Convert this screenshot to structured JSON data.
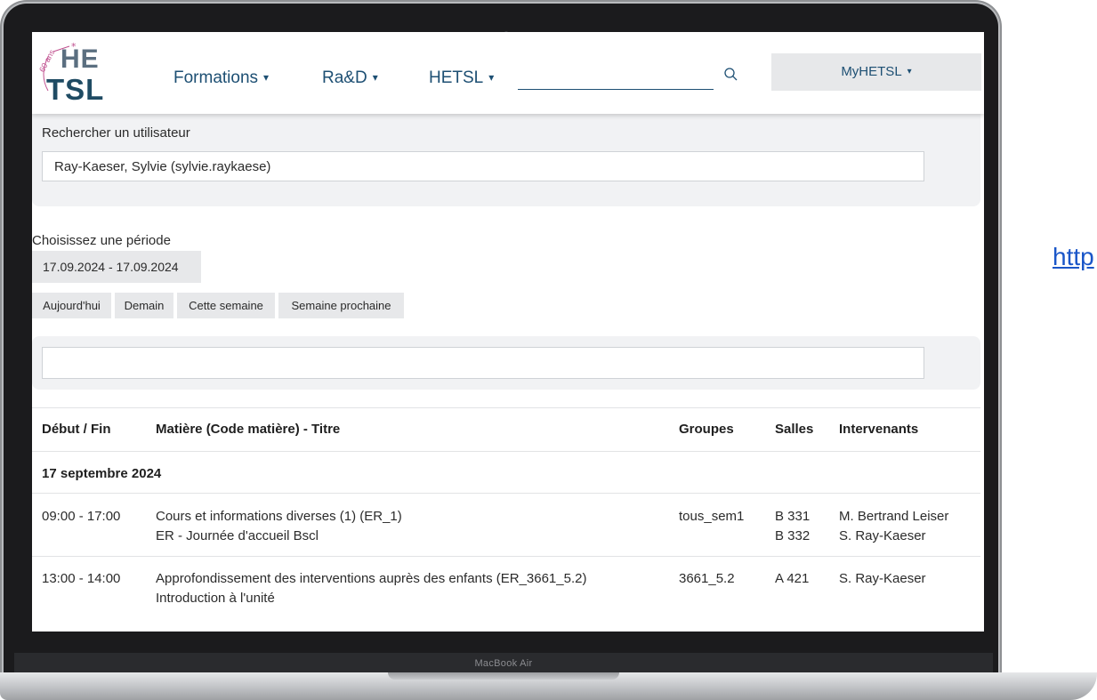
{
  "device": {
    "brand_label": "MacBook Air"
  },
  "side_link": "http",
  "header": {
    "logo": {
      "top": "HE",
      "bottom": "TSL",
      "anniversary": "60 ans"
    },
    "nav": [
      {
        "label": "Formations"
      },
      {
        "label": "Ra&D"
      },
      {
        "label": "HETSL"
      }
    ],
    "search": {
      "value": "",
      "placeholder": ""
    },
    "account_menu": "MyHETSL"
  },
  "user_search": {
    "label": "Rechercher un utilisateur",
    "value": "Ray-Kaeser, Sylvie (sylvie.raykaese)"
  },
  "period": {
    "label": "Choisissez une période",
    "value": "17.09.2024 - 17.09.2024",
    "quick_buttons": [
      "Aujourd'hui",
      "Demain",
      "Cette semaine",
      "Semaine prochaine"
    ]
  },
  "filter": {
    "value": ""
  },
  "table": {
    "headers": [
      "Début / Fin",
      "Matière (Code matière) - Titre",
      "Groupes",
      "Salles",
      "Intervenants"
    ],
    "date_group": "17 septembre 2024",
    "rows": [
      {
        "time": "09:00 - 17:00",
        "subject": "Cours et informations diverses (1) (ER_1)",
        "title": "ER - Journée d'accueil Bscl",
        "group": "tous_sem1",
        "room1": "B 331",
        "room2": "B 332",
        "speaker1": "M. Bertrand Leiser",
        "speaker2": "S. Ray-Kaeser"
      },
      {
        "time": "13:00 - 14:00",
        "subject": "Approfondissement des interventions auprès des enfants (ER_3661_5.2)",
        "title": "Introduction à l'unité",
        "group": "3661_5.2",
        "room1": "A 421",
        "speaker1": "S. Ray-Kaeser"
      }
    ]
  },
  "colors": {
    "brand_navy": "#1d4f73",
    "logo_pink": "#c0508f",
    "panel_grey": "#f1f2f4"
  }
}
